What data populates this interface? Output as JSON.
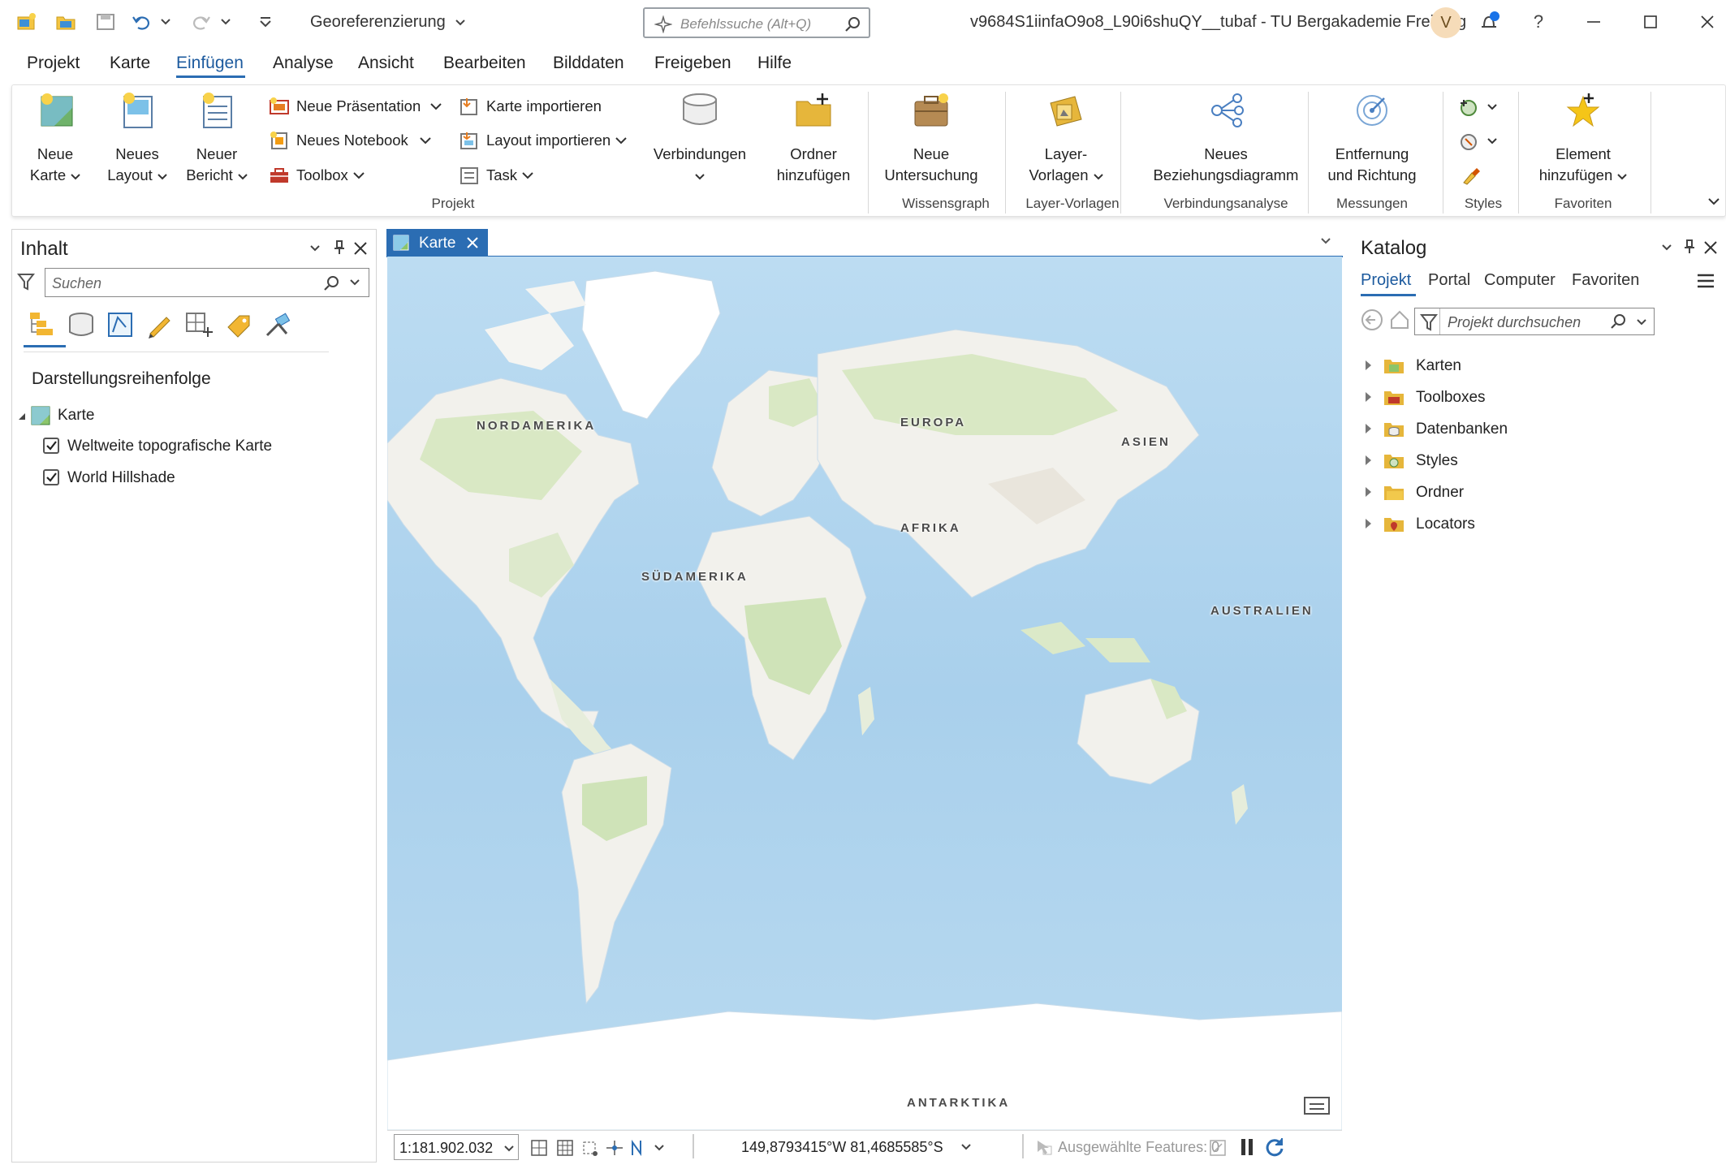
{
  "titlebar": {
    "document_menu": "Georeferenzierung",
    "command_search_placeholder": "Befehlssuche (Alt+Q)",
    "project_title": "v9684S1iinfaO9o8_L90i6shuQY__tubaf - TU Bergakademie Freiberg",
    "avatar_initial": "V",
    "help": "?"
  },
  "menu": {
    "items": [
      "Projekt",
      "Karte",
      "Einfügen",
      "Analyse",
      "Ansicht",
      "Bearbeiten",
      "Bilddaten",
      "Freigeben",
      "Hilfe"
    ],
    "active": "Einfügen"
  },
  "ribbon": {
    "projekt": {
      "group_label": "Projekt",
      "neue_karte": [
        "Neue",
        "Karte"
      ],
      "neues_layout": [
        "Neues",
        "Layout"
      ],
      "neuer_bericht": [
        "Neuer",
        "Bericht"
      ],
      "neue_praesentation": "Neue Präsentation",
      "neues_notebook": "Neues Notebook",
      "toolbox": "Toolbox",
      "karte_importieren": "Karte importieren",
      "layout_importieren": "Layout importieren",
      "task": "Task",
      "verbindungen": "Verbindungen",
      "ordner_hinzufuegen": [
        "Ordner",
        "hinzufügen"
      ]
    },
    "wissensgraph": {
      "group_label": "Wissensgraph",
      "neue_untersuchung": [
        "Neue",
        "Untersuchung"
      ]
    },
    "layer_vorlagen": {
      "group_label": "Layer-Vorlagen",
      "button": [
        "Layer-",
        "Vorlagen"
      ]
    },
    "verbindungsanalyse": {
      "group_label": "Verbindungsanalyse",
      "button": [
        "Neues",
        "Beziehungsdiagramm"
      ]
    },
    "messungen": {
      "group_label": "Messungen",
      "button": [
        "Entfernung",
        "und Richtung"
      ]
    },
    "styles": {
      "group_label": "Styles"
    },
    "favoriten": {
      "group_label": "Favoriten",
      "button": [
        "Element",
        "hinzufügen"
      ]
    }
  },
  "inhalt": {
    "title": "Inhalt",
    "search_placeholder": "Suchen",
    "section_title": "Darstellungsreihenfolge",
    "map_name": "Karte",
    "layers": [
      {
        "name": "Weltweite topografische Karte",
        "checked": true
      },
      {
        "name": "World Hillshade",
        "checked": true
      }
    ]
  },
  "map_view": {
    "tab_label": "Karte",
    "labels": {
      "nordamerika": "NORDAMERIKA",
      "europa": "EUROPA",
      "asien": "ASIEN",
      "afrika": "AFRIKA",
      "suedamerika": "SÜDAMERIKA",
      "australien": "AUSTRALIEN",
      "antarktika": "ANTARKTIKA"
    },
    "scale": "1:181.902.032",
    "coordinates": "149,8793415°W 81,4685585°S",
    "selected_features": "Ausgewählte Features: 0"
  },
  "katalog": {
    "title": "Katalog",
    "tabs": [
      "Projekt",
      "Portal",
      "Computer",
      "Favoriten"
    ],
    "active_tab": "Projekt",
    "search_placeholder": "Projekt durchsuchen",
    "items": [
      "Karten",
      "Toolboxes",
      "Datenbanken",
      "Styles",
      "Ordner",
      "Locators"
    ]
  },
  "colors": {
    "accent": "#2b6db3",
    "ocean": "#aed3ee",
    "land": "#f2f1ec",
    "vegetation": "#d9e8c4",
    "ice": "#ffffff"
  }
}
